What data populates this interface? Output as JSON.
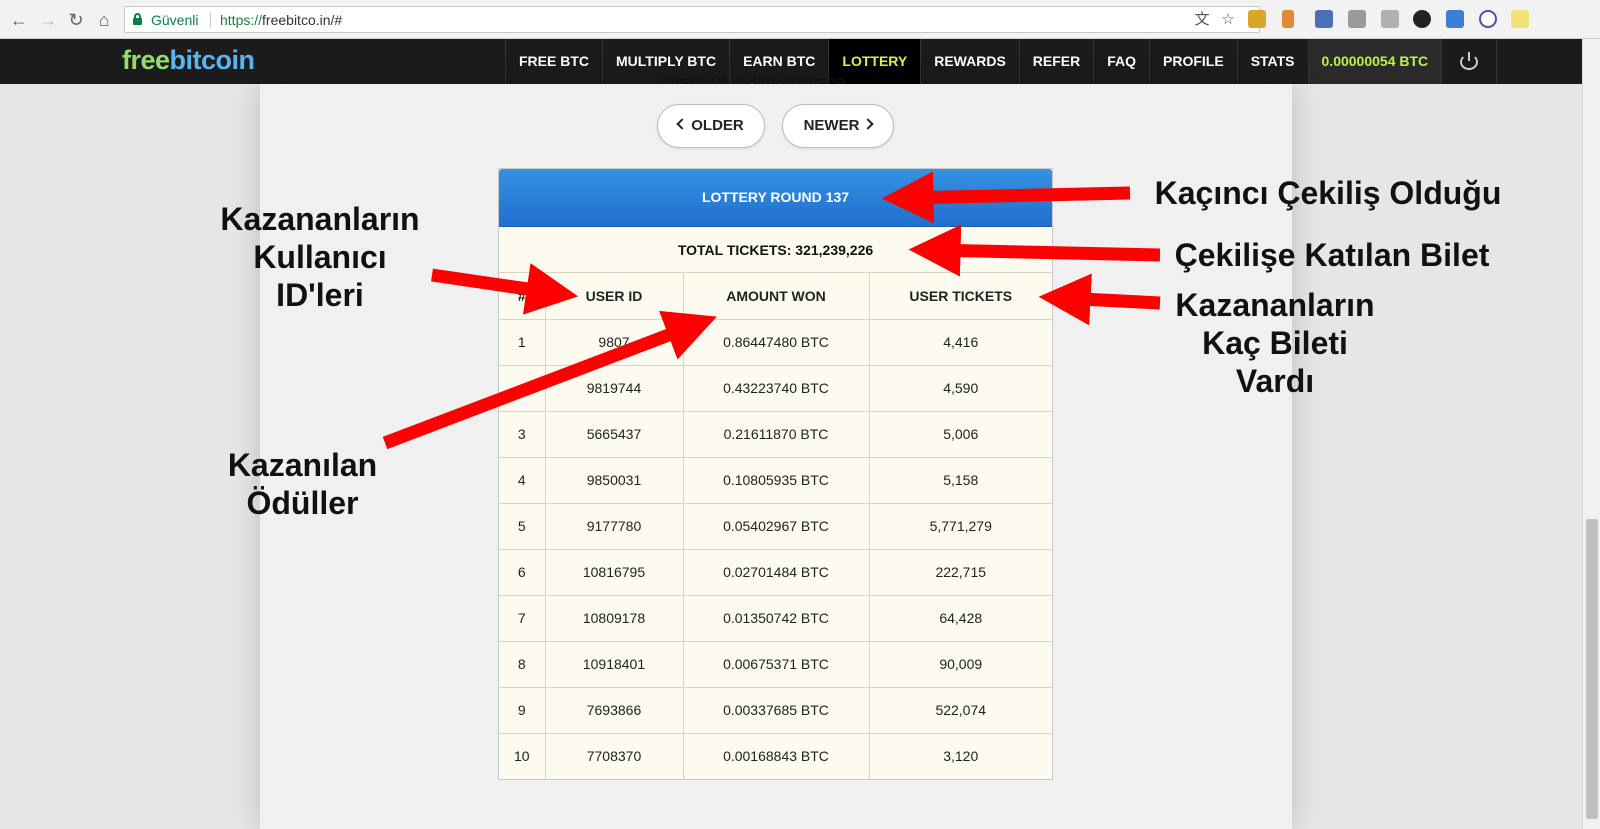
{
  "browser": {
    "secure_label": "Güvenli",
    "url_scheme": "https://",
    "url_rest": "freebitco.in/#"
  },
  "site": {
    "logo_free": "free",
    "logo_bit": "bitcoin",
    "nav": {
      "free_btc": "FREE BTC",
      "multiply_btc": "MULTIPLY BTC",
      "earn_btc": "EARN BTC",
      "lottery": "LOTTERY",
      "rewards": "REWARDS",
      "refer": "REFER",
      "faq": "FAQ",
      "profile": "PROFILE",
      "stats": "STATS",
      "balance": "0.00000054 BTC"
    },
    "accent_color": "#e3f14a",
    "balance_color": "#b8f24a"
  },
  "lottery": {
    "previous_heading": "PREVIOUS ROUND WINNERS",
    "older_label": "OLDER",
    "newer_label": "NEWER",
    "round_title": "LOTTERY ROUND 137",
    "total_tickets": "TOTAL TICKETS: 321,239,226",
    "columns": {
      "rank": "#",
      "user_id": "USER ID",
      "amount_won": "AMOUNT WON",
      "user_tickets": "USER TICKETS"
    },
    "rows": [
      {
        "rank": "1",
        "user_id": "9807",
        "amount": "0.86447480 BTC",
        "tickets": "4,416"
      },
      {
        "rank": "",
        "user_id": "9819744",
        "amount": "0.43223740 BTC",
        "tickets": "4,590"
      },
      {
        "rank": "3",
        "user_id": "5665437",
        "amount": "0.21611870 BTC",
        "tickets": "5,006"
      },
      {
        "rank": "4",
        "user_id": "9850031",
        "amount": "0.10805935 BTC",
        "tickets": "5,158"
      },
      {
        "rank": "5",
        "user_id": "9177780",
        "amount": "0.05402967 BTC",
        "tickets": "5,771,279"
      },
      {
        "rank": "6",
        "user_id": "10816795",
        "amount": "0.02701484 BTC",
        "tickets": "222,715"
      },
      {
        "rank": "7",
        "user_id": "10809178",
        "amount": "0.01350742 BTC",
        "tickets": "64,428"
      },
      {
        "rank": "8",
        "user_id": "10918401",
        "amount": "0.00675371 BTC",
        "tickets": "90,009"
      },
      {
        "rank": "9",
        "user_id": "7693866",
        "amount": "0.00337685 BTC",
        "tickets": "522,074"
      },
      {
        "rank": "10",
        "user_id": "7708370",
        "amount": "0.00168843 BTC",
        "tickets": "3,120"
      }
    ]
  },
  "annotations": {
    "round_note": "Kaçıncı Çekiliş Olduğu",
    "tickets_note": "Çekilişe Katılan Bilet",
    "winners_tickets_note": "Kazananların\nKaç Bileti\nVardı",
    "user_ids_note": "Kazananların\nKullanıcı\nID'leri",
    "prizes_note": "Kazanılan\nÖdüller",
    "arrow_color": "#ff0000"
  }
}
